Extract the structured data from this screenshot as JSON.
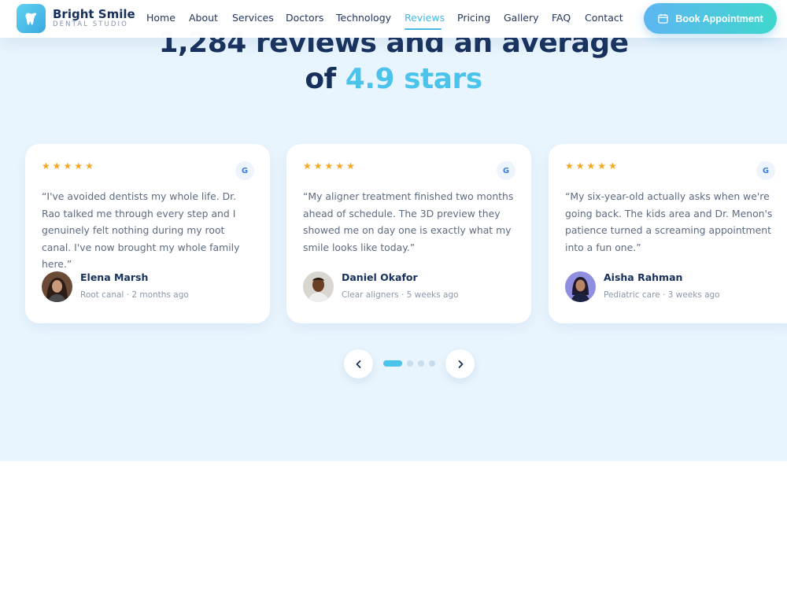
{
  "brand": {
    "name": "Bright Smile",
    "tagline": "DENTAL STUDIO"
  },
  "nav": {
    "items": [
      {
        "label": "Home"
      },
      {
        "label": "About"
      },
      {
        "label": "Services"
      },
      {
        "label": "Doctors"
      },
      {
        "label": "Technology"
      },
      {
        "label": "Reviews",
        "active": true
      },
      {
        "label": "Pricing"
      },
      {
        "label": "Gallery"
      },
      {
        "label": "FAQ"
      },
      {
        "label": "Contact"
      }
    ],
    "cta_label": "Book Appointment"
  },
  "heading": {
    "line1": "1,284 reviews and an average",
    "line2_prefix": "of",
    "line2_accent": "4.9 stars"
  },
  "reviews": [
    {
      "rating": 5,
      "source_icon": "google-icon",
      "source_letter": "G",
      "quote": "“I've avoided dentists my whole life. Dr. Rao talked me through every step and I genuinely felt nothing during my root canal. I've now brought my whole family here.”",
      "name": "Elena Marsh",
      "meta": "Root canal · 2 months ago"
    },
    {
      "rating": 5,
      "source_icon": "google-icon",
      "source_letter": "G",
      "quote": "“My aligner treatment finished two months ahead of schedule. The 3D preview they showed me on day one is exactly what my smile looks like today.”",
      "name": "Daniel Okafor",
      "meta": "Clear aligners · 5 weeks ago"
    },
    {
      "rating": 5,
      "source_icon": "google-icon",
      "source_letter": "G",
      "quote": "“My six-year-old actually asks when we're going back. The kids area and Dr. Menon's patience turned a screaming appointment into a fun one.”",
      "name": "Aisha Rahman",
      "meta": "Pediatric care · 3 weeks ago"
    }
  ],
  "carousel": {
    "pages": 4,
    "active_page": 1
  },
  "colors": {
    "navy": "#17305b",
    "accent": "#4cc3ea",
    "star": "#f5a623",
    "section_bg": "#e9f5fe"
  }
}
